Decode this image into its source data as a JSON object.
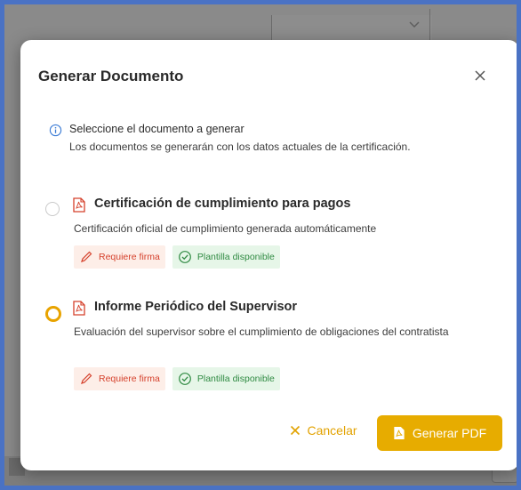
{
  "modal": {
    "title": "Generar Documento",
    "close_icon": "close-icon"
  },
  "info": {
    "icon": "info-icon",
    "title": "Seleccione el documento a generar",
    "subtitle": "Los documentos se generarán con los datos actuales de la certificación."
  },
  "options": [
    {
      "title": "Certificación de cumplimiento para pagos",
      "description": "Certificación oficial de cumplimiento generada automáticamente",
      "selected": false,
      "badges": {
        "signature": "Requiere firma",
        "template": "Plantilla disponible"
      }
    },
    {
      "title": "Informe Periódico del Supervisor",
      "description": "Evaluación del supervisor sobre el cumplimiento de obligaciones del contratista",
      "selected": false,
      "hovered": true,
      "badges": {
        "signature": "Requiere firma",
        "template": "Plantilla disponible"
      }
    }
  ],
  "footer": {
    "cancel_label": "Cancelar",
    "generate_label": "Generar PDF"
  },
  "colors": {
    "accent": "#e7ac00",
    "danger": "#d5402b",
    "success": "#2f8a42",
    "info": "#3a7bd5",
    "frame": "#4a72c4"
  }
}
